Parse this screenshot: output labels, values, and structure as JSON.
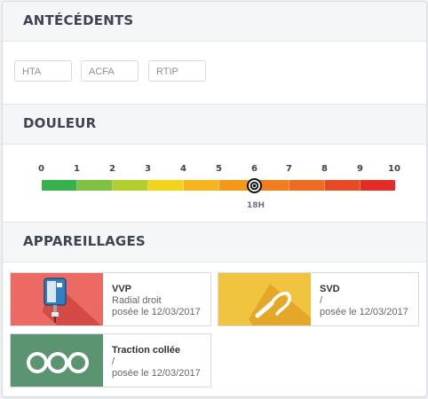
{
  "sections": {
    "antecedents": {
      "title": "ANTÉCÉDENTS",
      "tags": [
        "HTA",
        "ACFA",
        "RTIP"
      ]
    },
    "douleur": {
      "title": "DOULEUR",
      "scale": [
        "0",
        "1",
        "2",
        "3",
        "4",
        "5",
        "6",
        "7",
        "8",
        "9",
        "10"
      ],
      "current_value": 6,
      "current_time": "18H",
      "colors": [
        "#35b24a",
        "#7fc241",
        "#b4cf2b",
        "#f4d41b",
        "#f7b519",
        "#f49918",
        "#f27d1c",
        "#ef6b22",
        "#ea4a23",
        "#e52c24"
      ]
    },
    "appareillages": {
      "title": "APPAREILLAGES",
      "devices": [
        {
          "name": "VVP",
          "line1": "Radial droit",
          "line2": "posée le 12/03/2017",
          "icon": "iv-bag-icon",
          "color": "#ec6a63"
        },
        {
          "name": "SVD",
          "line1": "/",
          "line2": "posée le 12/03/2017",
          "icon": "catheter-icon",
          "color": "#f1c43f"
        },
        {
          "name": "Traction collée",
          "line1": "/",
          "line2": "posée le 12/03/2017",
          "icon": "traction-icon",
          "color": "#5b9470"
        }
      ]
    }
  }
}
